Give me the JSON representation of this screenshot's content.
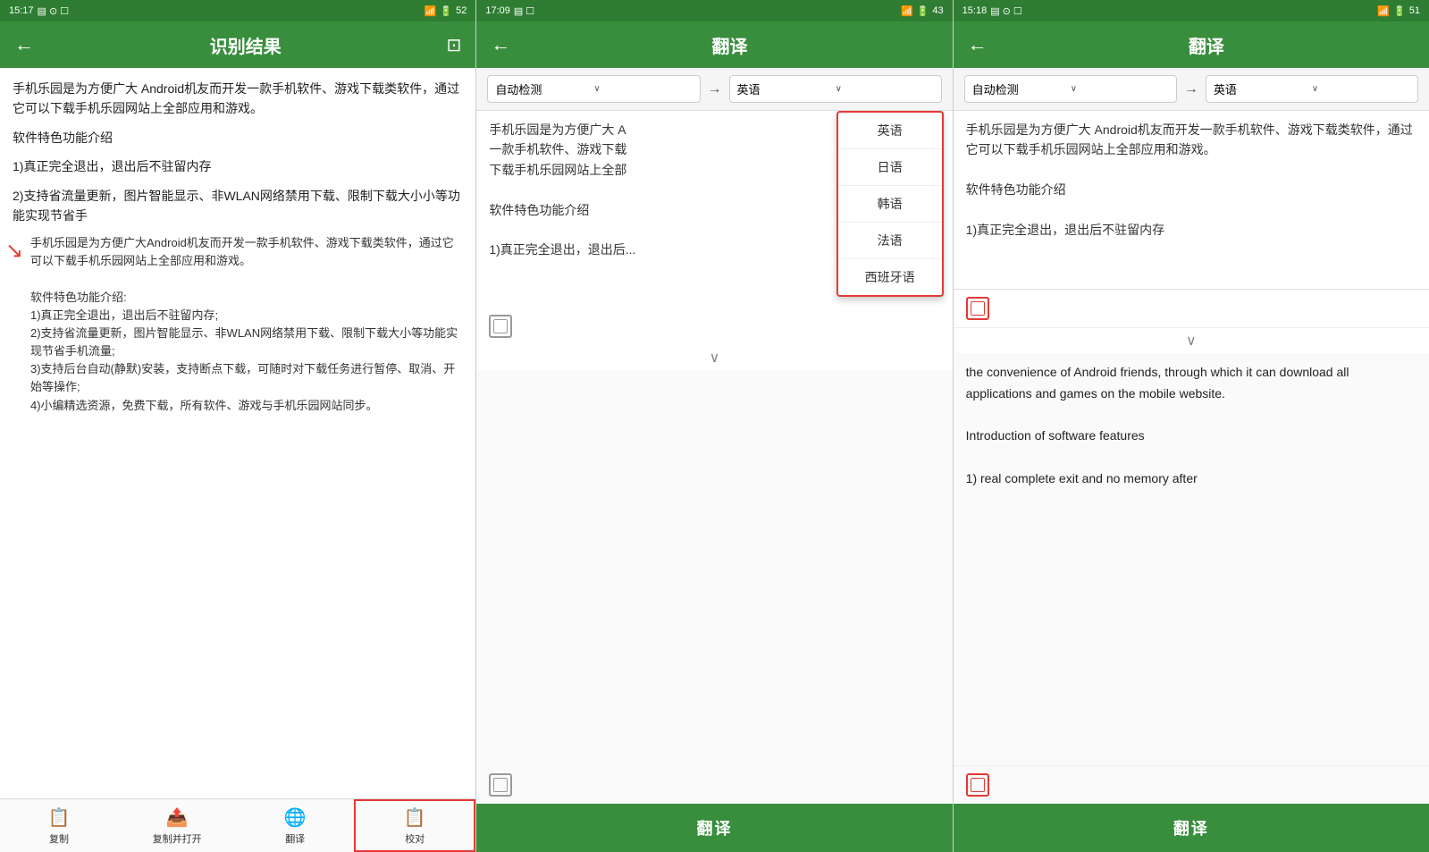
{
  "screens": [
    {
      "id": "screen1",
      "statusBar": {
        "time": "15:17",
        "battery": "52"
      },
      "header": {
        "title": "识别结果",
        "backLabel": "←",
        "actionIcon": "⊡"
      },
      "content": {
        "paragraphs": [
          "手机乐园是为方便广大  Android机友而开发一款手机软件、游戏下载类软件，通过它可以下载手机乐园网站上全部应用和游戏。",
          "软件特色功能介绍",
          "1)真正完全退出，退出后不驻留内存",
          "2)支持省流量更新，图片智能显示、非WLAN网络禁用下载、限制下载大小小等功能实现节省手"
        ],
        "annotation": {
          "text": "手机乐园是为方便广大Android机友而开发一款手机软件、游戏下载类软件，通过它可以下载手机乐园网站上全部应用和游戏。\n\n软件特色功能介绍:\n1)真正完全退出，退出后不驻留内存;\n2)支持省流量更新，图片智能显示、非WLAN网络禁用下载、限制下载大小等功能实现节省手机流量;\n3)支持后台自动(静默)安装，支持断点下载，可随时对下载任务进行暂停、取消、开始等操作;\n4)小编精选资源，免费下载，所有软件、游戏与手机乐园网站同步。"
        }
      },
      "toolbar": {
        "items": [
          {
            "label": "复制",
            "icon": "📋"
          },
          {
            "label": "复制并打开",
            "icon": "📤"
          },
          {
            "label": "翻译",
            "icon": "🌐"
          },
          {
            "label": "校对",
            "icon": "📋",
            "active": true,
            "highlighted": true
          }
        ]
      }
    },
    {
      "id": "screen2",
      "statusBar": {
        "time": "17:09",
        "battery": "43"
      },
      "header": {
        "title": "翻译",
        "backLabel": "←"
      },
      "sourceLang": "自动检测",
      "targetLang": "英语",
      "inputText": "手机乐园是为方便广大  A\n一款手机软件、游戏下载\n下载手机乐园网站上全部\n\n软件特色功能介绍\n\n1)真正完全退出，退出后...",
      "dropdown": {
        "items": [
          "英语",
          "日语",
          "韩语",
          "法语",
          "西班牙语"
        ]
      },
      "translateButton": "翻译"
    },
    {
      "id": "screen3",
      "statusBar": {
        "time": "15:18",
        "battery": "51"
      },
      "header": {
        "title": "翻译",
        "backLabel": "←"
      },
      "sourceLang": "自动检测",
      "targetLang": "英语",
      "inputText": "手机乐园是为方便广大  Android机友而开发一款手机软件、游戏下载类软件，通过它可以下载手机乐园网站上全部应用和游戏。\n\n软件特色功能介绍\n\n1)真正完全退出，退出后不驻留内存",
      "outputText": {
        "para1": "the convenience of Android friends, through which it can download all applications and games on the mobile website.",
        "para2": "Introduction of software features",
        "para3": "1) real complete exit and no memory after"
      },
      "translateButton": "翻译"
    }
  ]
}
